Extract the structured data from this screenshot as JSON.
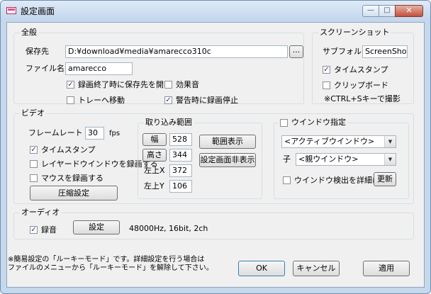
{
  "window": {
    "title": "設定画面",
    "minimize_symbol": "—",
    "maximize_symbol": "□",
    "close_symbol": "✕"
  },
  "general": {
    "title": "全般",
    "save_to_label": "保存先",
    "save_to_value": "D:¥download¥media¥amarecco310c",
    "browse_label": "...",
    "filename_label": "ファイル名",
    "filename_value": "amarecco",
    "open_folder_label": "録画終了時に保存先を開く",
    "open_folder_checked": true,
    "sound_effect_label": "効果音",
    "sound_effect_checked": false,
    "tray_move_label": "トレーへ移動",
    "tray_move_checked": false,
    "warn_stop_label": "警告時に録画停止",
    "warn_stop_checked": true
  },
  "screenshot": {
    "title": "スクリーンショット",
    "subfolder_label": "サブフォルダ",
    "subfolder_value": "ScreenShot",
    "timestamp_label": "タイムスタンプ",
    "timestamp_checked": true,
    "clipboard_label": "クリップボード",
    "clipboard_checked": false,
    "hint": "※CTRL+Sキーで撮影"
  },
  "video": {
    "title": "ビデオ",
    "framerate_label": "フレームレート",
    "framerate_value": "30",
    "fps_label": "fps",
    "timestamp_label": "タイムスタンプ",
    "timestamp_checked": true,
    "layered_label": "レイヤードウインドウを録画する",
    "layered_checked": false,
    "mouse_label": "マウスを録画する",
    "mouse_checked": false,
    "compression_button": "圧縮設定"
  },
  "capture": {
    "title": "取り込み範囲",
    "width_label": "幅",
    "width_value": "528",
    "height_label": "高さ",
    "height_value": "344",
    "left_x_label": "左上X",
    "left_x_value": "372",
    "left_y_label": "左上Y",
    "left_y_value": "106",
    "show_range_button": "範囲表示",
    "hide_settings_button": "設定画面非表示"
  },
  "window_select": {
    "title": "ウインドウ指定",
    "enabled": false,
    "parent_value": "<アクティブウインドウ>",
    "child_label": "子",
    "child_value": "<親ウインドウ>",
    "detail_label": "ウインドウ検出を詳細に行う",
    "detail_checked": false,
    "refresh_button": "更新",
    "dropdown_arrow": "▼"
  },
  "audio": {
    "title": "オーディオ",
    "record_label": "録音",
    "record_checked": true,
    "settings_button": "設定",
    "format_text": "48000Hz, 16bit, 2ch"
  },
  "footer": {
    "note_line1": "※簡易設定の「ルーキーモード」です。詳細設定を行う場合は",
    "note_line2": "ファイルのメニューから「ルーキーモード」を解除して下さい。",
    "ok_button": "OK",
    "cancel_button": "キャンセル",
    "apply_button": "適用"
  },
  "colors": {
    "frame": "#c6d8ec",
    "client_bg": "#f0f0f0",
    "close_red": "#c2513c",
    "check_mark": "#1f3c8a"
  }
}
